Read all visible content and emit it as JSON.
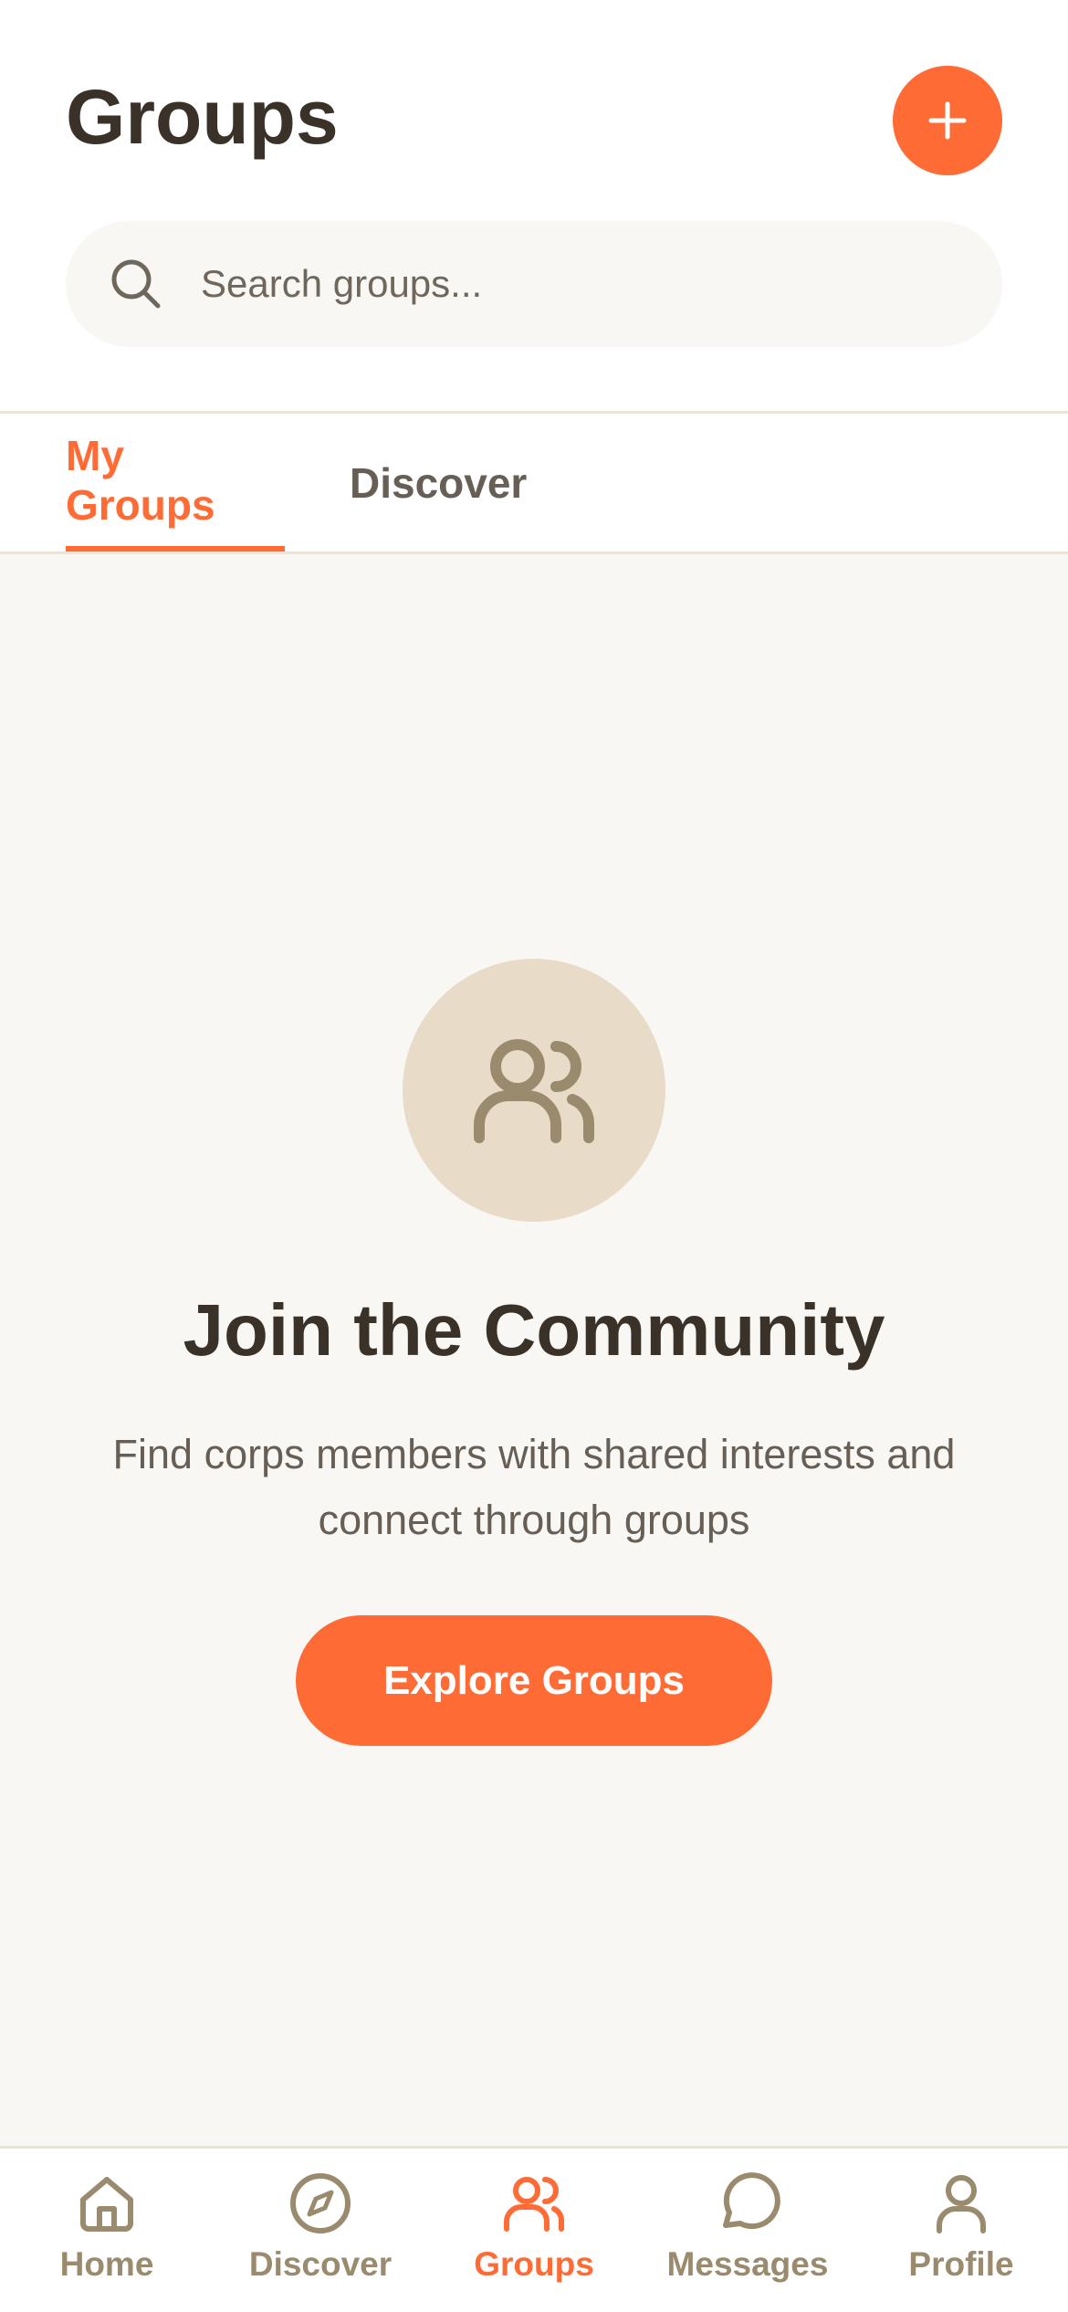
{
  "header": {
    "title": "Groups",
    "add_icon": "plus-icon"
  },
  "search": {
    "placeholder": "Search groups...",
    "value": "",
    "icon": "search-icon"
  },
  "tabs": [
    {
      "label": "My Groups",
      "active": true
    },
    {
      "label": "Discover",
      "active": false
    }
  ],
  "empty_state": {
    "icon": "users-icon",
    "title": "Join the Community",
    "description": "Find corps members with shared interests and connect through groups",
    "button_label": "Explore Groups"
  },
  "bottom_nav": {
    "items": [
      {
        "label": "Home",
        "icon": "home-icon",
        "active": false
      },
      {
        "label": "Discover",
        "icon": "compass-icon",
        "active": false
      },
      {
        "label": "Groups",
        "icon": "users-icon",
        "active": true
      },
      {
        "label": "Messages",
        "icon": "chat-bubble-icon",
        "active": false
      },
      {
        "label": "Profile",
        "icon": "user-icon",
        "active": false
      }
    ]
  },
  "colors": {
    "accent": "#FF6B35",
    "text_dark": "#3A3228",
    "text_muted": "#675F55",
    "nav_inactive": "#9A8A6E",
    "empty_circle": "#E8DCC8",
    "background": "#F8F7F4"
  }
}
